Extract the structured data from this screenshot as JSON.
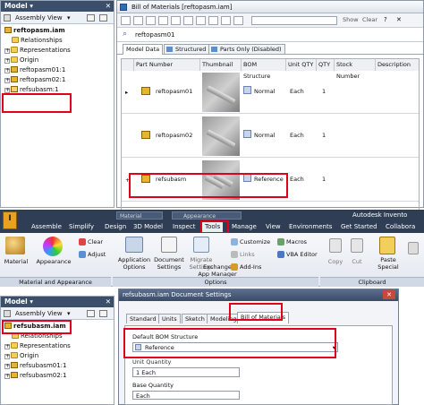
{
  "top_tree": {
    "header": "Model ▾",
    "view": "Assembly View",
    "items": [
      {
        "label": "reftopasm.iam",
        "bold": true
      },
      {
        "label": "Relationships"
      },
      {
        "label": "Representations"
      },
      {
        "label": "Origin"
      },
      {
        "label": "reftopasm01:1"
      },
      {
        "label": "reftopasm02:1"
      },
      {
        "label": "refsubasm:1"
      }
    ]
  },
  "bom": {
    "title": "Bill of Materials [reftopasm.iam]",
    "show_label": "Show",
    "clear_label": "Clear",
    "filter_value": "reftopasm01",
    "tabs": [
      "Model Data",
      "Structured",
      "Parts Only (Disabled)"
    ],
    "columns": [
      "Part Number",
      "Thumbnail",
      "BOM Structure",
      "Unit QTY",
      "QTY",
      "Stock Number",
      "Description"
    ],
    "rows": [
      {
        "part": "reftopasm01",
        "structure": "Normal",
        "unit": "Each",
        "qty": "1"
      },
      {
        "part": "reftopasm02",
        "structure": "Normal",
        "unit": "Each",
        "qty": "1"
      },
      {
        "part": "refsubasm",
        "structure": "Reference",
        "unit": "Each",
        "qty": "1"
      }
    ]
  },
  "ribbon": {
    "tabs": [
      "Assemble",
      "Simplify",
      "Design",
      "3D Model",
      "Inspect",
      "Tools",
      "Manage",
      "View",
      "Environments",
      "Get Started",
      "Collabora"
    ],
    "qat_items": [
      "Material",
      "Appearance"
    ],
    "app_title": "Autodesk Invento",
    "buttons": {
      "material": "Material",
      "appearance": "Appearance",
      "clear": "Clear",
      "adjust": "Adjust",
      "app_options": "Application\nOptions",
      "doc_settings": "Document\nSettings",
      "migrate": "Migrate\nSettings",
      "customize": "Customize",
      "links": "Links",
      "exchange": "Exchange\nApp Manager",
      "macros": "Macros",
      "vba": "VBA Editor",
      "addins": "Add-Ins",
      "copy": "Copy",
      "cut": "Cut",
      "paste": "Paste\nSpecial"
    },
    "groups": [
      "Material and Appearance",
      "Options",
      "Clipboard"
    ]
  },
  "bottom_tree": {
    "header": "Model ▾",
    "view": "Assembly View",
    "items": [
      {
        "label": "refsubasm.iam",
        "bold": true
      },
      {
        "label": "Relationships"
      },
      {
        "label": "Representations"
      },
      {
        "label": "Origin"
      },
      {
        "label": "refsubasm01:1"
      },
      {
        "label": "refsubasm02:1"
      }
    ]
  },
  "doc_settings": {
    "title": "refsubasm.iam Document Settings",
    "tabs": [
      "Standard",
      "Units",
      "Sketch",
      "Modeling",
      "Bill of Materials"
    ],
    "default_bom_label": "Default BOM Structure",
    "default_bom_value": "Reference",
    "unit_qty_label": "Unit Quantity",
    "unit_qty_value": "1 Each",
    "base_qty_label": "Base Quantity",
    "base_qty_value": "Each"
  },
  "colors": {
    "highlight": "#e0001b",
    "ribbon_dark": "#2f3e55",
    "accent": "#3c4f6a"
  }
}
